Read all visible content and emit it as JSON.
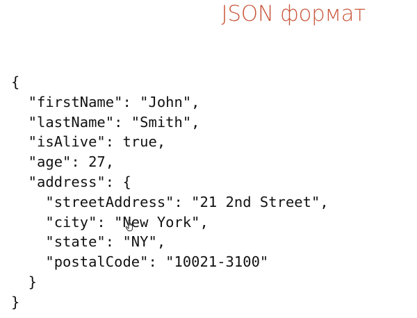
{
  "slide": {
    "title": "JSON формат",
    "title_color": "#c9583c",
    "code_lines": [
      "{",
      "  \"firstName\": \"John\",",
      "  \"lastName\": \"Smith\",",
      "  \"isAlive\": true,",
      "  \"age\": 27,",
      "  \"address\": {",
      "    \"streetAddress\": \"21 2nd Street\",",
      "    \"city\": \"New York\",",
      "    \"state\": \"NY\",",
      "    \"postalCode\": \"10021-3100\"",
      "  }",
      "}"
    ],
    "cursor_icon": "hand-pointer-icon"
  }
}
